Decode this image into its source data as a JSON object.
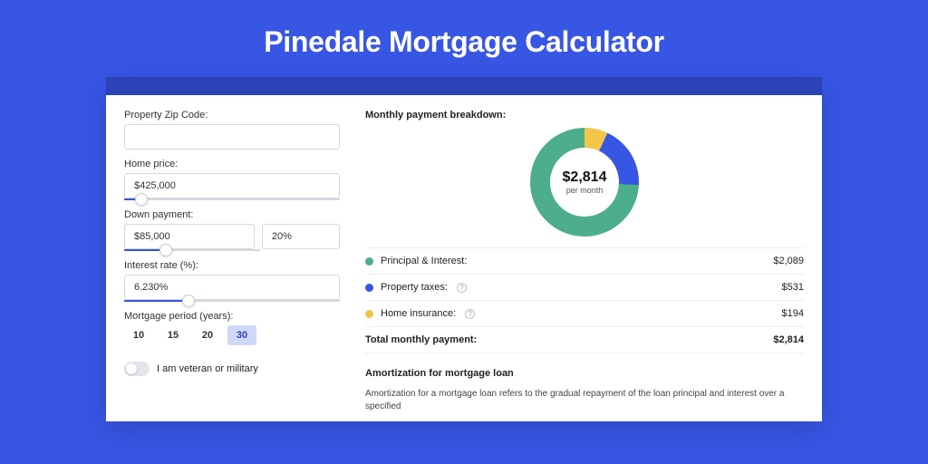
{
  "title": "Pinedale Mortgage Calculator",
  "form": {
    "zip_label": "Property Zip Code:",
    "zip_value": "",
    "home_price_label": "Home price:",
    "home_price_value": "$425,000",
    "home_price_slider_pct": 8,
    "down_payment_label": "Down payment:",
    "down_payment_value": "$85,000",
    "down_payment_pct_value": "20%",
    "down_payment_slider_pct": 20,
    "interest_label": "Interest rate (%):",
    "interest_value": "6.230%",
    "interest_slider_pct": 30,
    "period_label": "Mortgage period (years):",
    "period_options": [
      "10",
      "15",
      "20",
      "30"
    ],
    "period_active_index": 3,
    "veteran_label": "I am veteran or military"
  },
  "breakdown": {
    "title": "Monthly payment breakdown:",
    "center_amount": "$2,814",
    "center_caption": "per month",
    "rows": [
      {
        "color": "green",
        "label": "Principal & Interest:",
        "info": false,
        "value": "$2,089"
      },
      {
        "color": "blue",
        "label": "Property taxes:",
        "info": true,
        "value": "$531"
      },
      {
        "color": "yellow",
        "label": "Home insurance:",
        "info": true,
        "value": "$194"
      }
    ],
    "total_label": "Total monthly payment:",
    "total_value": "$2,814"
  },
  "amortization": {
    "title": "Amortization for mortgage loan",
    "text": "Amortization for a mortgage loan refers to the gradual repayment of the loan principal and interest over a specified"
  },
  "chart_data": {
    "type": "pie",
    "title": "Monthly payment breakdown",
    "categories": [
      "Principal & Interest",
      "Property taxes",
      "Home insurance"
    ],
    "values": [
      2089,
      531,
      194
    ],
    "colors": [
      "#4cae8a",
      "#3756e4",
      "#f2c54b"
    ],
    "total": 2814,
    "center_label": "$2,814 per month"
  }
}
